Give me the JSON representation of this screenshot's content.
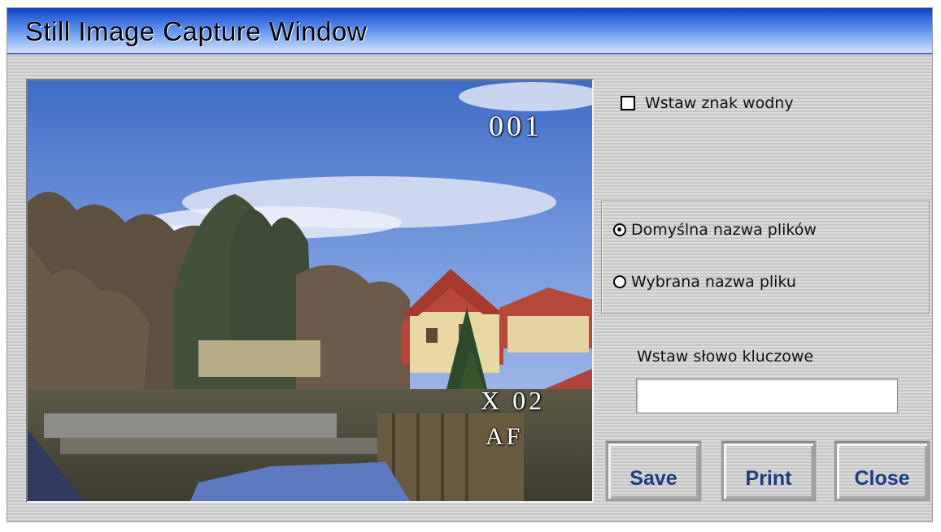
{
  "window": {
    "title": "Still Image Capture Window"
  },
  "preview": {
    "counter": "001",
    "zoom": "X 02",
    "focus": "AF"
  },
  "options": {
    "watermark_label": "Wstaw znak wodny",
    "watermark_checked": false,
    "filename_default_label": "Domyślna nazwa plików",
    "filename_custom_label": "Wybrana nazwa pliku",
    "filename_selected": "default"
  },
  "keyword": {
    "label": "Wstaw słowo kluczowe",
    "value": ""
  },
  "buttons": {
    "save": "Save",
    "print": "Print",
    "close": "Close"
  },
  "colors": {
    "title_bar": "#2b62d8",
    "button_text": "#1d3c84"
  }
}
